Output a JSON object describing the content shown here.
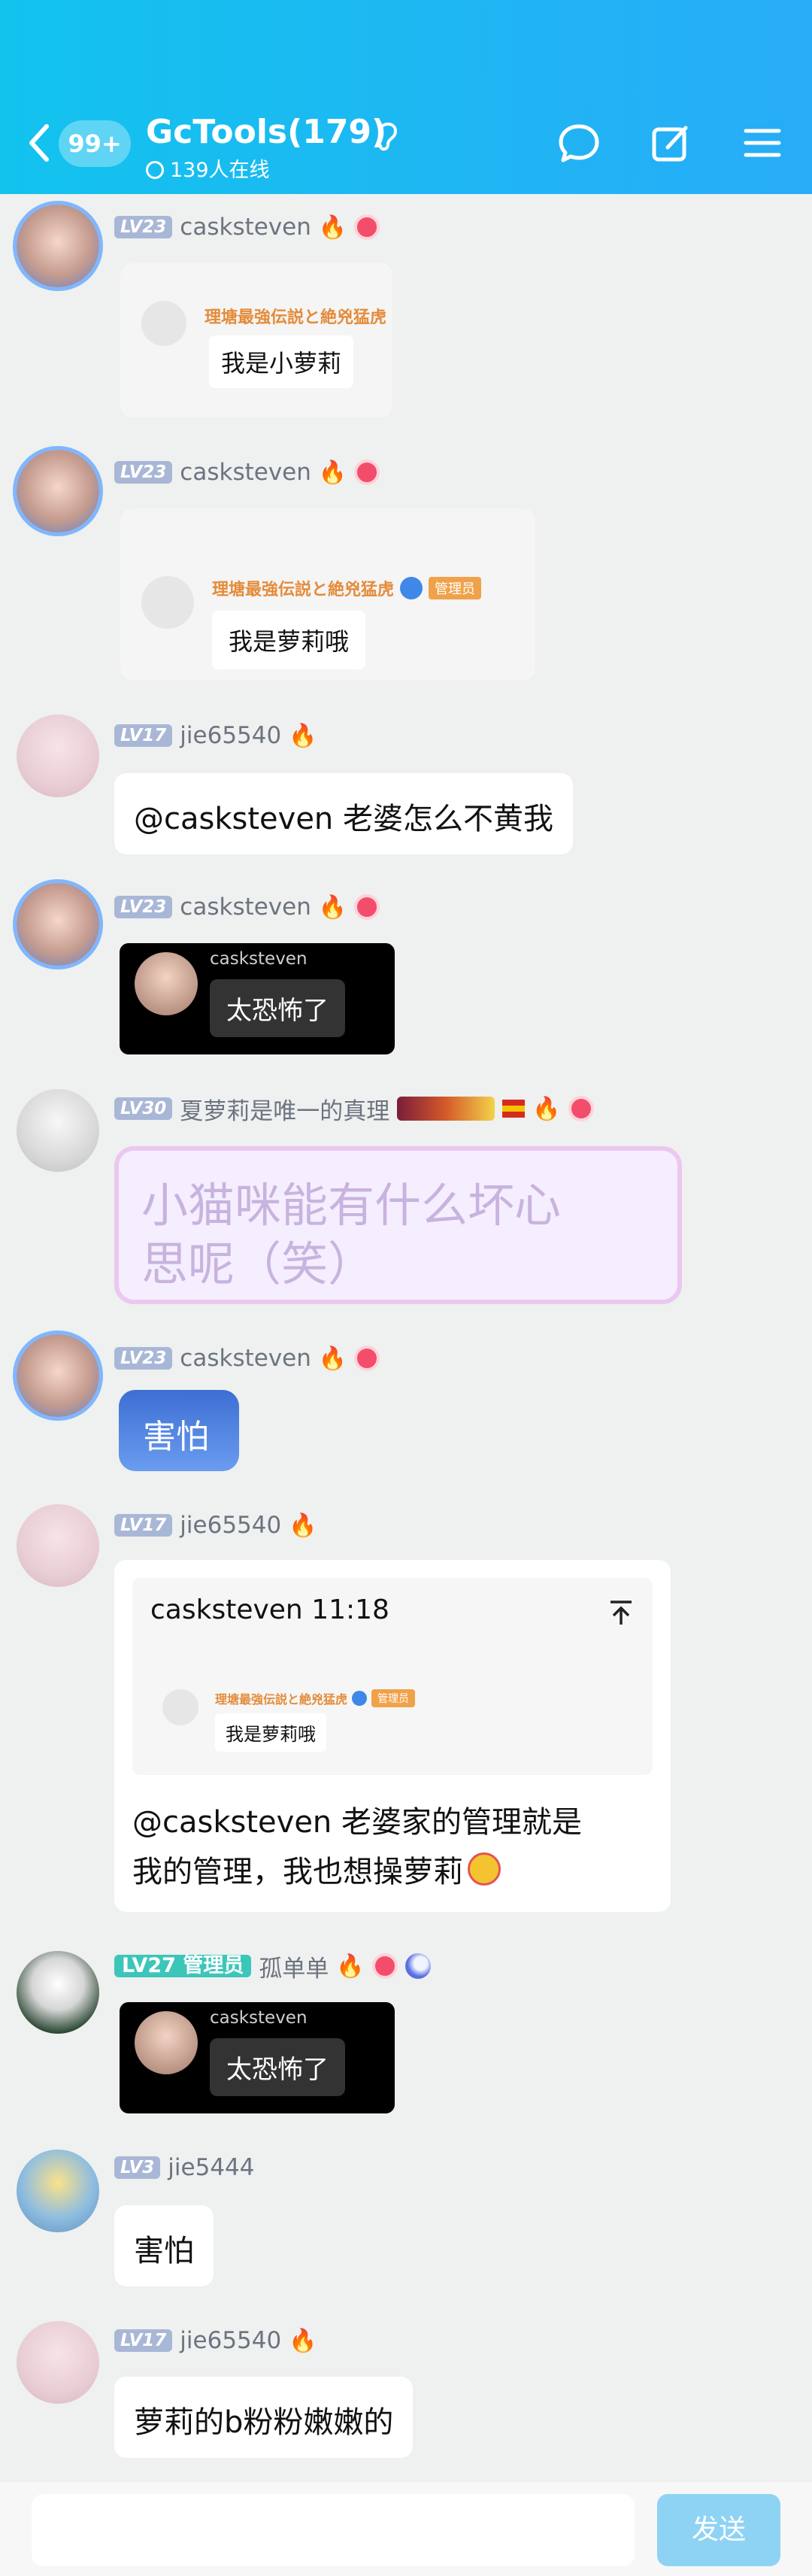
{
  "header": {
    "unread_badge": "99+",
    "title": "GcTools(179)",
    "online": "139人在线"
  },
  "colors": {
    "header_start": "#12c3ee",
    "header_end": "#28acf7",
    "send_button": "#8fd3f4",
    "level_badge": "#a9b7d6"
  },
  "messages": [
    {
      "level": "LV23",
      "user": "casksteven",
      "quote_title": "理塘最強伝説と絶兇猛虎",
      "quote_text": "我是小萝莉"
    },
    {
      "level": "LV23",
      "user": "casksteven",
      "quote_title": "理塘最強伝説と絶兇猛虎",
      "quote_badge": "管理员",
      "quote_text": "我是萝莉哦"
    },
    {
      "level": "LV17",
      "user": "jie65540",
      "text": "@casksteven 老婆怎么不黄我"
    },
    {
      "level": "LV23",
      "user": "casksteven",
      "sticker_name": "casksteven",
      "sticker_text": "太恐怖了"
    },
    {
      "level": "LV30",
      "user": "夏萝莉是唯一的真理",
      "text_line1": "小猫咪能有什么坏心",
      "text_line2": "思呢（笑）"
    },
    {
      "level": "LV23",
      "user": "casksteven",
      "text": "害怕"
    },
    {
      "level": "LV17",
      "user": "jie65540",
      "reply_header": "casksteven 11:18",
      "quote_title": "理塘最強伝説と絶兇猛虎",
      "quote_badge": "管理员",
      "quote_text": "我是萝莉哦",
      "text_line1": "@casksteven 老婆家的管理就是",
      "text_line2": "我的管理，我也想操萝莉"
    },
    {
      "level": "LV27",
      "role": "管理员",
      "user": "孤单单",
      "sticker_name": "casksteven",
      "sticker_text": "太恐怖了"
    },
    {
      "level": "LV3",
      "user": "jie5444",
      "text": "害怕"
    },
    {
      "level": "LV17",
      "user": "jie65540",
      "text": "萝莉的b粉粉嫩嫩的"
    }
  ],
  "input": {
    "send_label": "发送"
  }
}
